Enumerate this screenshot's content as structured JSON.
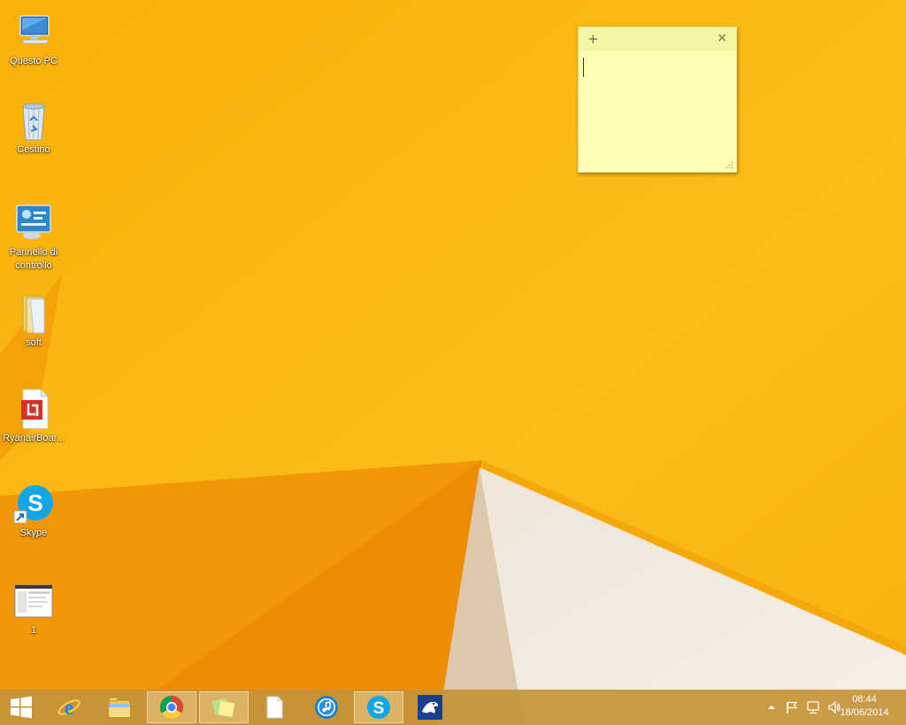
{
  "desktop": {
    "icons": [
      {
        "label": "Questo PC",
        "icon": "this-pc-icon"
      },
      {
        "label": "Cestino",
        "icon": "recycle-bin-icon"
      },
      {
        "label": "Pannello di controllo",
        "icon": "control-panel-icon"
      },
      {
        "label": "soft",
        "icon": "folder-icon"
      },
      {
        "label": "RyanairBoar...",
        "icon": "pdf-file-icon"
      },
      {
        "label": "Skype",
        "icon": "skype-shortcut-icon"
      },
      {
        "label": "1",
        "icon": "image-file-icon"
      }
    ]
  },
  "sticky_note": {
    "add_glyph": "+",
    "close_glyph": "×",
    "text": ""
  },
  "taskbar": {
    "buttons": [
      {
        "name": "start-button",
        "icon": "windows-logo-icon"
      },
      {
        "name": "internet-explorer",
        "icon": "internet-explorer-icon"
      },
      {
        "name": "file-explorer",
        "icon": "file-explorer-icon"
      },
      {
        "name": "google-chrome",
        "icon": "chrome-icon",
        "active": true
      },
      {
        "name": "sticky-notes",
        "icon": "sticky-notes-icon",
        "active": true
      },
      {
        "name": "notepad",
        "icon": "blank-document-icon"
      },
      {
        "name": "itunes",
        "icon": "itunes-icon"
      },
      {
        "name": "skype",
        "icon": "skype-icon",
        "active": true
      },
      {
        "name": "app-frog",
        "icon": "frog-app-icon"
      }
    ],
    "tray": {
      "icons": [
        "show-hidden-icons-icon",
        "action-center-flag-icon",
        "network-icon",
        "volume-icon"
      ],
      "time": "08:44",
      "date": "18/06/2014"
    }
  },
  "colors": {
    "wallpaper_main": "#f7b10c",
    "wallpaper_dark": "#f08f05",
    "sticky_bg": "#fdfdb3",
    "taskbar": "#c4943a"
  }
}
